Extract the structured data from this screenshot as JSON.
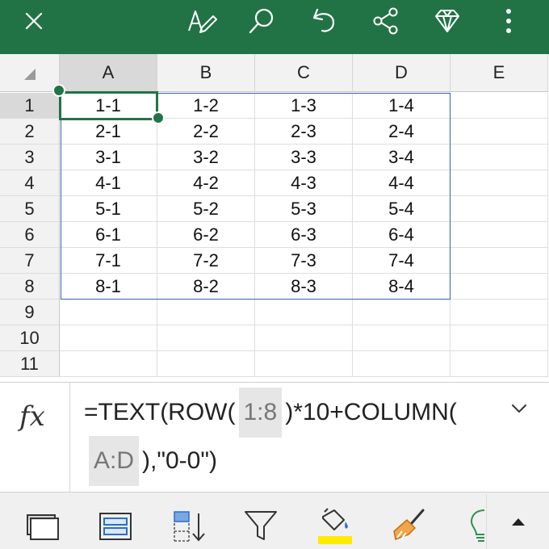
{
  "toolbar": {
    "background": "#217346",
    "icons": [
      "close-icon",
      "edit-pen-icon",
      "search-icon",
      "undo-icon",
      "share-icon",
      "premium-diamond-icon",
      "more-vertical-icon"
    ]
  },
  "sheet": {
    "columns": [
      "A",
      "B",
      "C",
      "D",
      "E"
    ],
    "rows": [
      "1",
      "2",
      "3",
      "4",
      "5",
      "6",
      "7",
      "8",
      "9",
      "10",
      "11"
    ],
    "cells": [
      [
        "1-1",
        "1-2",
        "1-3",
        "1-4",
        ""
      ],
      [
        "2-1",
        "2-2",
        "2-3",
        "2-4",
        ""
      ],
      [
        "3-1",
        "3-2",
        "3-3",
        "3-4",
        ""
      ],
      [
        "4-1",
        "4-2",
        "4-3",
        "4-4",
        ""
      ],
      [
        "5-1",
        "5-2",
        "5-3",
        "5-4",
        ""
      ],
      [
        "6-1",
        "6-2",
        "6-3",
        "6-4",
        ""
      ],
      [
        "7-1",
        "7-2",
        "7-3",
        "7-4",
        ""
      ],
      [
        "8-1",
        "8-2",
        "8-3",
        "8-4",
        ""
      ],
      [
        "",
        "",
        "",
        "",
        ""
      ],
      [
        "",
        "",
        "",
        "",
        ""
      ],
      [
        "",
        "",
        "",
        "",
        ""
      ]
    ],
    "active_cell": "A1"
  },
  "formula_bar": {
    "fx_label": "fx",
    "line1_before": "=TEXT(ROW(",
    "line1_ref": "1:8",
    "line1_after": ")*10+COLUMN(",
    "line2_ref": "A:D",
    "line2_after": "),\"0-0\")"
  },
  "bottom_toolbar": {
    "icons": [
      "freeze-panes-icon",
      "format-cells-icon",
      "sort-icon",
      "filter-icon",
      "fill-color-icon",
      "clear-format-icon",
      "ideas-lightbulb-icon",
      "expand-up-icon"
    ],
    "fill_highlight": "#ffeb00"
  }
}
